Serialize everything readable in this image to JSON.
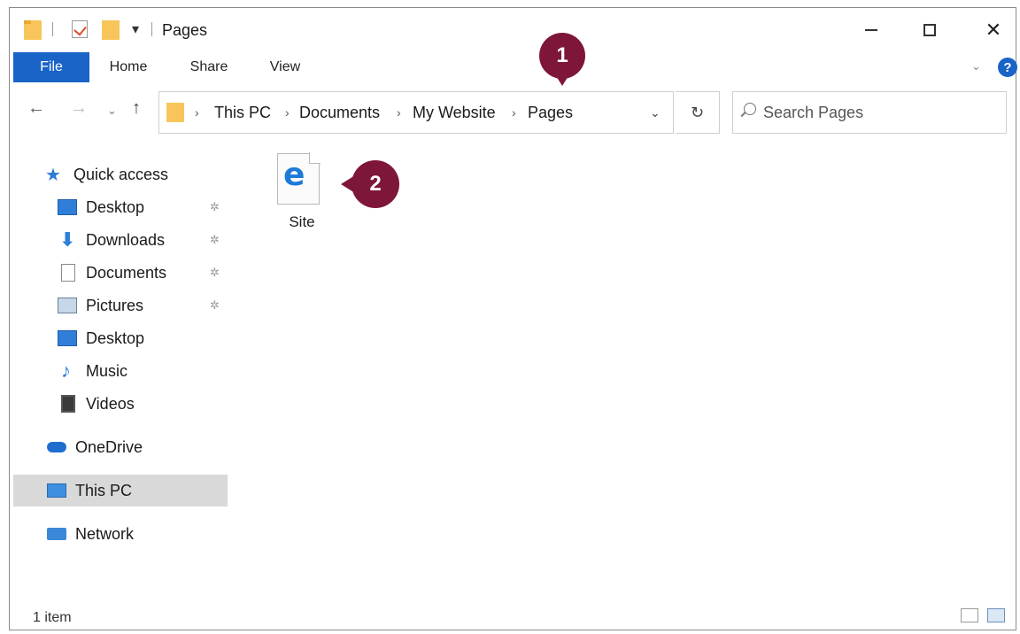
{
  "window": {
    "title": "Pages",
    "quick_access_dropdown": "▾"
  },
  "ribbon": {
    "tabs": [
      "File",
      "Home",
      "Share",
      "View"
    ],
    "expand_glyph": "⌄",
    "help_glyph": "?"
  },
  "navigation": {
    "back": "←",
    "forward": "→",
    "recent": "⌄",
    "up": "↑",
    "breadcrumb": [
      "This PC",
      "Documents",
      "My Website",
      "Pages"
    ],
    "separator": "›",
    "dropdown": "⌄",
    "refresh": "↻"
  },
  "search": {
    "placeholder": "Search Pages"
  },
  "sidebar": {
    "items": [
      {
        "label": "Quick access",
        "icon": "star-icon"
      },
      {
        "label": "Desktop",
        "icon": "desktop-icon",
        "pinned": true
      },
      {
        "label": "Downloads",
        "icon": "download-icon",
        "pinned": true
      },
      {
        "label": "Documents",
        "icon": "documents-icon",
        "pinned": true
      },
      {
        "label": "Pictures",
        "icon": "pictures-icon",
        "pinned": true
      },
      {
        "label": "Desktop",
        "icon": "desktop-icon"
      },
      {
        "label": "Music",
        "icon": "music-icon"
      },
      {
        "label": "Videos",
        "icon": "videos-icon"
      },
      {
        "label": "OneDrive",
        "icon": "onedrive-icon"
      },
      {
        "label": "This PC",
        "icon": "this-pc-icon",
        "selected": true
      },
      {
        "label": "Network",
        "icon": "network-icon"
      }
    ],
    "pin_glyph": "✲",
    "star_glyph": "★",
    "download_glyph": "⬇",
    "music_glyph": "♪"
  },
  "content": {
    "files": [
      {
        "name": "Site",
        "icon": "edge-html-file-icon",
        "icon_letter": "e"
      }
    ]
  },
  "markers": [
    "1",
    "2"
  ],
  "status": {
    "item_count": "1 item"
  },
  "colors": {
    "accent": "#1a63c7",
    "marker": "#7e1639",
    "folder": "#f8c55a",
    "selection": "#d9d9d9"
  }
}
